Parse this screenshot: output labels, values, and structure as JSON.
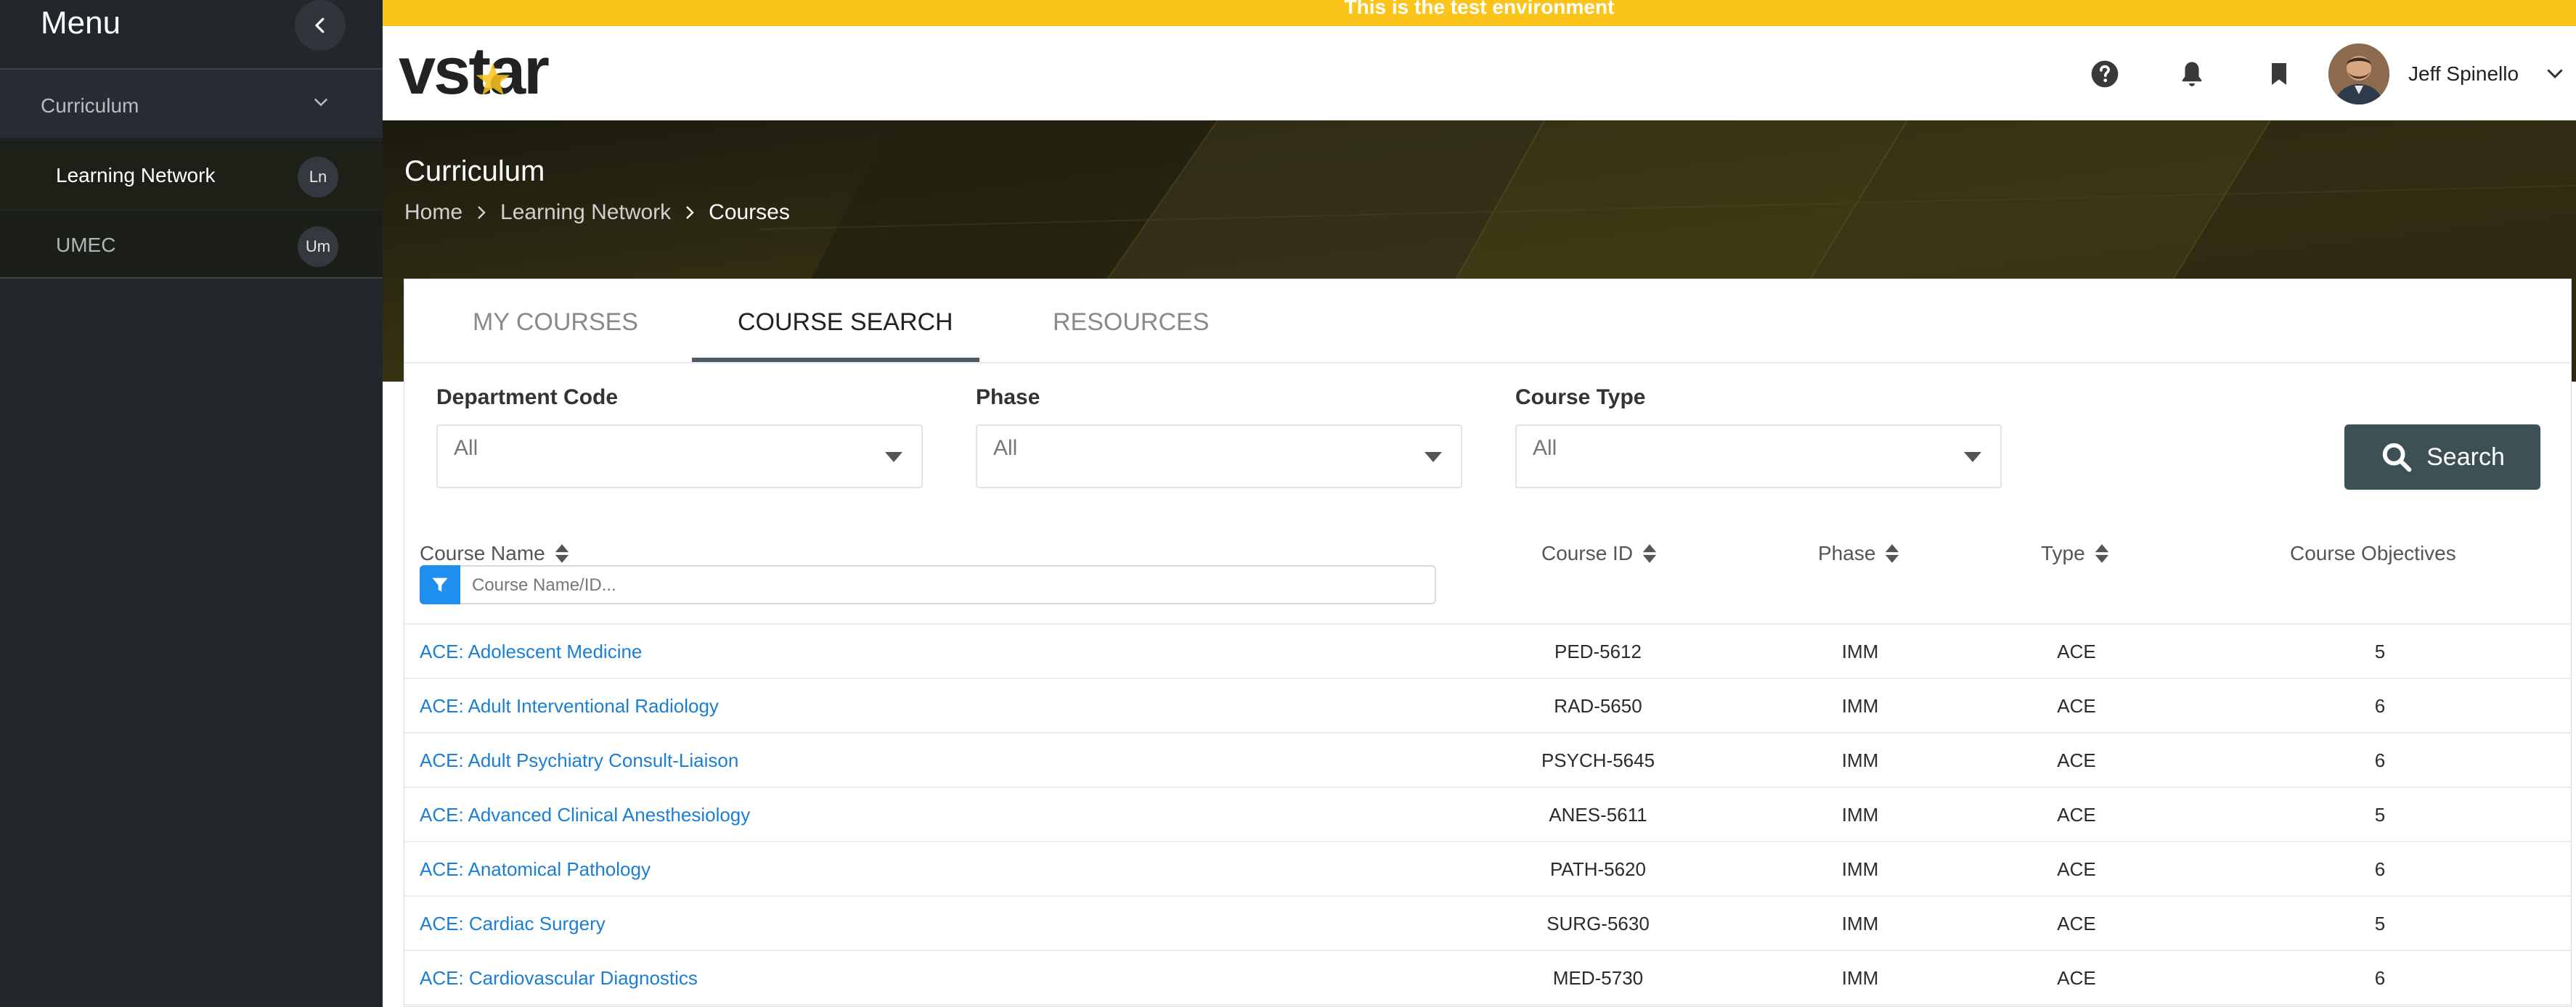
{
  "colors": {
    "banner": "#fbc41a",
    "sidebar": "#22272b",
    "link": "#1a7fd4",
    "search_button": "#3d5056",
    "filter_button": "#1f8fef"
  },
  "sidebar": {
    "title": "Menu",
    "collapse_icon": "chevron-left-icon",
    "section": {
      "label": "Curriculum",
      "icon": "chevron-down-icon"
    },
    "items": [
      {
        "label": "Learning Network",
        "badge": "Ln"
      },
      {
        "label": "UMEC",
        "badge": "Um"
      }
    ]
  },
  "banner": {
    "text": "This is the test environment"
  },
  "header": {
    "logo_text": "vstar",
    "icons": [
      "help-icon",
      "bell-icon",
      "bookmark-icon"
    ],
    "user_name": "Jeff Spinello"
  },
  "hero": {
    "title": "Curriculum",
    "breadcrumbs": [
      "Home",
      "Learning Network",
      "Courses"
    ]
  },
  "tabs": [
    {
      "label": "MY COURSES"
    },
    {
      "label": "COURSE SEARCH",
      "active": true
    },
    {
      "label": "RESOURCES"
    }
  ],
  "filters": {
    "department": {
      "label": "Department Code",
      "value": "All"
    },
    "phase": {
      "label": "Phase",
      "value": "All"
    },
    "course_type": {
      "label": "Course Type",
      "value": "All"
    },
    "search_label": "Search"
  },
  "table": {
    "headers": {
      "name": "Course Name",
      "id": "Course ID",
      "phase": "Phase",
      "type": "Type",
      "objectives": "Course Objectives"
    },
    "name_filter_placeholder": "Course Name/ID...",
    "rows": [
      {
        "name": "ACE: Adolescent Medicine",
        "id": "PED-5612",
        "phase": "IMM",
        "type": "ACE",
        "objectives": "5"
      },
      {
        "name": "ACE: Adult Interventional Radiology",
        "id": "RAD-5650",
        "phase": "IMM",
        "type": "ACE",
        "objectives": "6"
      },
      {
        "name": "ACE: Adult Psychiatry Consult-Liaison",
        "id": "PSYCH-5645",
        "phase": "IMM",
        "type": "ACE",
        "objectives": "6"
      },
      {
        "name": "ACE: Advanced Clinical Anesthesiology",
        "id": "ANES-5611",
        "phase": "IMM",
        "type": "ACE",
        "objectives": "5"
      },
      {
        "name": "ACE: Anatomical Pathology",
        "id": "PATH-5620",
        "phase": "IMM",
        "type": "ACE",
        "objectives": "6"
      },
      {
        "name": "ACE: Cardiac Surgery",
        "id": "SURG-5630",
        "phase": "IMM",
        "type": "ACE",
        "objectives": "5"
      },
      {
        "name": "ACE: Cardiovascular Diagnostics",
        "id": "MED-5730",
        "phase": "IMM",
        "type": "ACE",
        "objectives": "6"
      }
    ]
  }
}
